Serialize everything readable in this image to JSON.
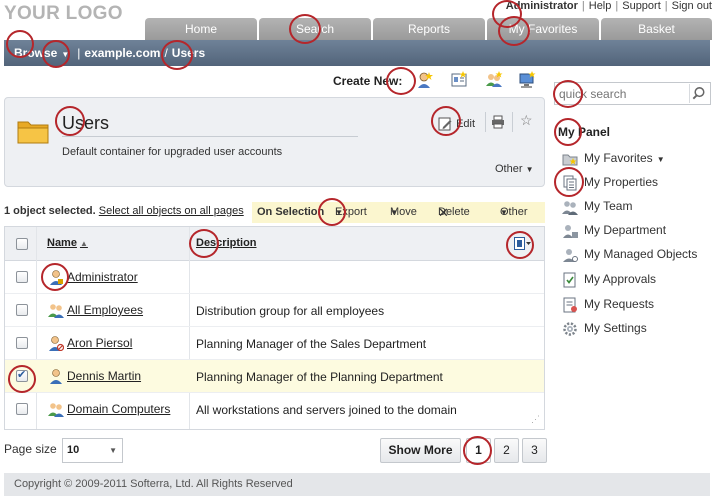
{
  "logo": "YOUR LOGO",
  "top_links": {
    "user": "Administrator",
    "help": "Help",
    "support": "Support",
    "signout": "Sign out"
  },
  "tabs": [
    "Home",
    "Search",
    "Reports",
    "My Favorites",
    "Basket"
  ],
  "breadcrumb": {
    "browse": "Browse",
    "domain": "example.com",
    "current": "Users"
  },
  "create_new_label": "Create New:",
  "container": {
    "title": "Users",
    "description": "Default container for upgraded user accounts",
    "edit_label": "Edit",
    "other_label": "Other"
  },
  "selection": {
    "count_text": "1 object selected.",
    "select_all": "Select all objects on all pages"
  },
  "action_bar": {
    "label": "On Selection",
    "export": "Export",
    "move": "Move",
    "delete": "Delete",
    "other": "Other"
  },
  "table": {
    "columns": {
      "name": "Name",
      "description": "Description"
    },
    "rows": [
      {
        "name": "Administrator",
        "description": "",
        "checked": false,
        "icon": "user-admin-icon"
      },
      {
        "name": "All Employees",
        "description": "Distribution group for all employees",
        "checked": false,
        "icon": "group-icon"
      },
      {
        "name": "Aron Piersol",
        "description": "Planning Manager of the Sales Department",
        "checked": false,
        "icon": "user-disabled-icon"
      },
      {
        "name": "Dennis Martin",
        "description": "Planning Manager of the Planning Department",
        "checked": true,
        "icon": "user-icon"
      },
      {
        "name": "Domain Computers",
        "description": "All workstations and servers joined to the domain",
        "checked": false,
        "icon": "group-icon"
      }
    ]
  },
  "pager": {
    "page_size_label": "Page size",
    "page_size": "10",
    "show_more": "Show More",
    "pages": [
      "1",
      "2",
      "3"
    ],
    "current_page": "1"
  },
  "footer": "Copyright © 2009-2011 Softerra, Ltd. All Rights Reserved",
  "quick_search": {
    "placeholder": "quick search"
  },
  "my_panel": {
    "title": "My Panel",
    "items": [
      "My Favorites",
      "My Properties",
      "My Team",
      "My Department",
      "My Managed Objects",
      "My Approvals",
      "My Requests",
      "My Settings"
    ]
  },
  "colors": {
    "nav": "#5f7189",
    "tab": "#a8a8a8",
    "highlight": "#fdfbe0",
    "marker": "#b5262b"
  }
}
